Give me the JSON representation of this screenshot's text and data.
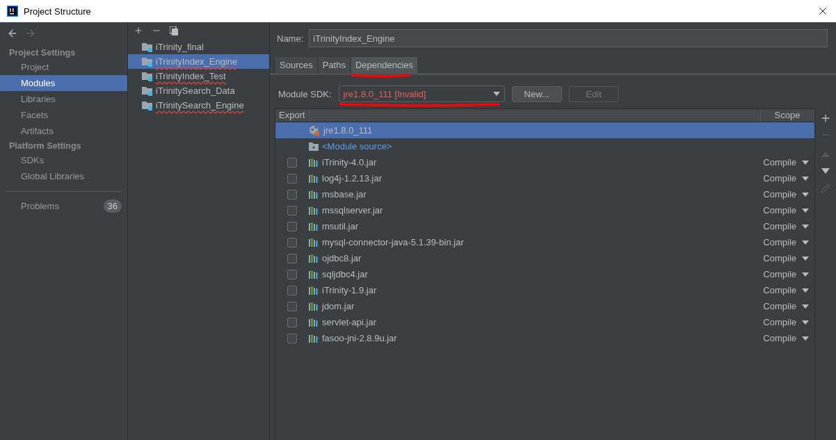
{
  "window": {
    "title": "Project Structure"
  },
  "sidebar": {
    "sections": [
      {
        "heading": "Project Settings",
        "items": [
          {
            "label": "Project",
            "selected": false
          },
          {
            "label": "Modules",
            "selected": true
          },
          {
            "label": "Libraries",
            "selected": false
          },
          {
            "label": "Facets",
            "selected": false
          },
          {
            "label": "Artifacts",
            "selected": false
          }
        ]
      },
      {
        "heading": "Platform Settings",
        "items": [
          {
            "label": "SDKs",
            "selected": false
          },
          {
            "label": "Global Libraries",
            "selected": false
          }
        ]
      }
    ],
    "problems": {
      "label": "Problems",
      "count": "36"
    }
  },
  "modules": [
    {
      "name": "iTrinity_final",
      "selected": false,
      "misspelled": false
    },
    {
      "name": "iTrinityIndex_Engine",
      "selected": true,
      "misspelled": true
    },
    {
      "name": "iTrinityIndex_Test",
      "selected": false,
      "misspelled": true
    },
    {
      "name": "iTrinitySearch_Data",
      "selected": false,
      "misspelled": false
    },
    {
      "name": "iTrinitySearch_Engine",
      "selected": false,
      "misspelled": true
    }
  ],
  "name_field": {
    "label": "Name:",
    "value": "iTrinityIndex_Engine"
  },
  "tabs": [
    {
      "label": "Sources",
      "selected": false
    },
    {
      "label": "Paths",
      "selected": false
    },
    {
      "label": "Dependencies",
      "selected": true
    }
  ],
  "sdk": {
    "label": "Module SDK:",
    "value": "jre1.8.0_111 [Invalid]",
    "invalid": true
  },
  "buttons": [
    {
      "label": "New...",
      "disabled": false
    },
    {
      "label": "Edit",
      "disabled": true
    }
  ],
  "table": {
    "columns": [
      "Export",
      "Scope"
    ],
    "rows": [
      {
        "kind": "sdk",
        "name": "jre1.8.0_111",
        "selected": true
      },
      {
        "kind": "source",
        "name": "<Module source>",
        "selected": false
      },
      {
        "kind": "jar",
        "name": "iTrinity-4.0.jar",
        "selected": false,
        "checked": false,
        "scope": "Compile"
      },
      {
        "kind": "jar",
        "name": "log4j-1.2.13.jar",
        "selected": false,
        "checked": false,
        "scope": "Compile"
      },
      {
        "kind": "jar",
        "name": "msbase.jar",
        "selected": false,
        "checked": false,
        "scope": "Compile"
      },
      {
        "kind": "jar",
        "name": "mssqlserver.jar",
        "selected": false,
        "checked": false,
        "scope": "Compile"
      },
      {
        "kind": "jar",
        "name": "msutil.jar",
        "selected": false,
        "checked": false,
        "scope": "Compile"
      },
      {
        "kind": "jar",
        "name": "mysql-connector-java-5.1.39-bin.jar",
        "selected": false,
        "checked": false,
        "scope": "Compile"
      },
      {
        "kind": "jar",
        "name": "ojdbc8.jar",
        "selected": false,
        "checked": false,
        "scope": "Compile"
      },
      {
        "kind": "jar",
        "name": "sqljdbc4.jar",
        "selected": false,
        "checked": false,
        "scope": "Compile"
      },
      {
        "kind": "jar",
        "name": "iTrinity-1.9.jar",
        "selected": false,
        "checked": false,
        "scope": "Compile"
      },
      {
        "kind": "jar",
        "name": "jdom.jar",
        "selected": false,
        "checked": false,
        "scope": "Compile"
      },
      {
        "kind": "jar",
        "name": "servlet-api.jar",
        "selected": false,
        "checked": false,
        "scope": "Compile"
      },
      {
        "kind": "jar",
        "name": "fasoo-jni-2.8.9u.jar",
        "selected": false,
        "checked": false,
        "scope": "Compile"
      }
    ]
  }
}
